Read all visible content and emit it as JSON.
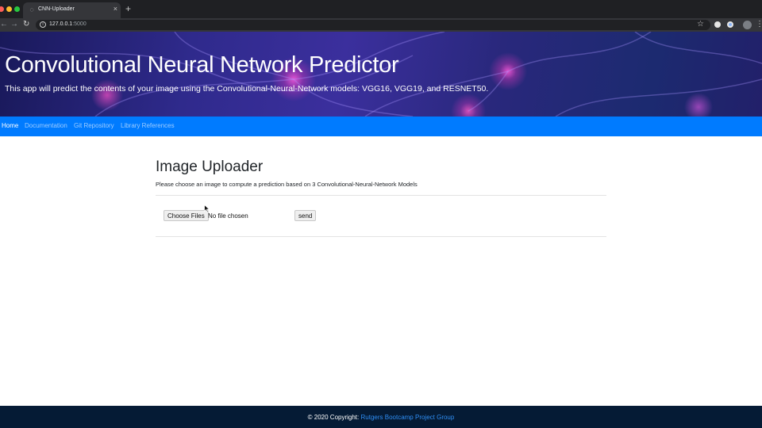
{
  "browser": {
    "tab_title": "CNN-Uploader",
    "tab_close": "×",
    "new_tab": "+",
    "url_host": "127.0.0.1",
    "url_port": ":5000",
    "back": "←",
    "forward": "→",
    "reload": "↻",
    "star": "☆",
    "menu": "⋮",
    "icons": [
      "tab-favicon-icon",
      "info-icon",
      "star-icon",
      "extension-icon",
      "profile-avatar-icon",
      "menu-icon"
    ]
  },
  "hero": {
    "title": "Convolutional Neural Network Predictor",
    "subtitle": "This app will predict the contents of your image using the Convolutional-Neural-Network models: VGG16, VGG19, and RESNET50."
  },
  "navbar": {
    "links": [
      "Home",
      "Documentation",
      "Git Repository",
      "Library References"
    ],
    "active": "Home",
    "color": "#007bff"
  },
  "main": {
    "title": "Image Uploader",
    "description": "Please choose an image to compute a prediction based on 3 Convolutional-Neural-Network Models",
    "choose_files_label": "Choose Files",
    "file_status": "No file chosen",
    "send_label": "send"
  },
  "footer": {
    "copyright": "© 2020 Copyright:",
    "link_text": "Rutgers Bootcamp Project Group",
    "link_color": "#2f8ef4"
  }
}
